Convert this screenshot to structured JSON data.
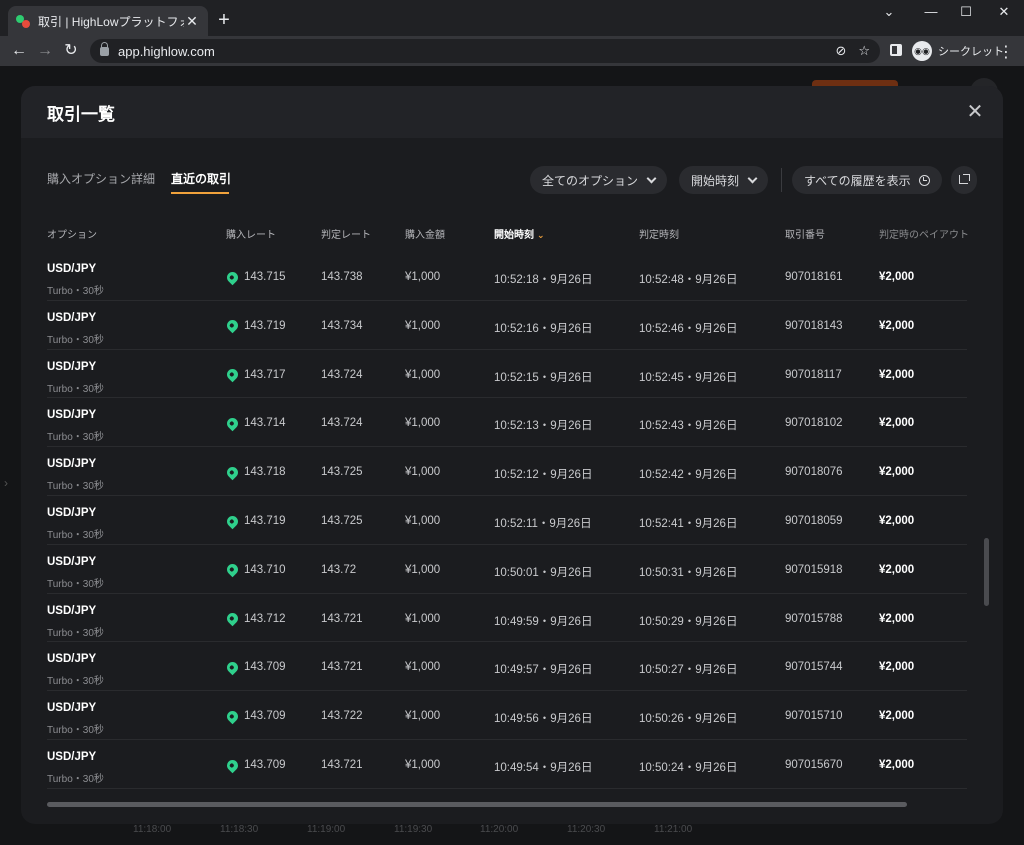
{
  "browser": {
    "tab_title": "取引 | HighLowプラットフォーム",
    "tab_close": "✕",
    "new_tab": "+",
    "url": "app.highlow.com",
    "incognito_label": "シークレット",
    "window_controls": {
      "minimize": "—",
      "maximize": "☐",
      "close": "✕",
      "dropdown": "⌄"
    }
  },
  "background": {
    "times": [
      "11:18:00",
      "11:18:30",
      "11:19:00",
      "11:19:30",
      "11:20:00",
      "11:20:30",
      "11:21:00"
    ]
  },
  "modal": {
    "title": "取引一覧",
    "close": "✕",
    "tabs": [
      {
        "label": "購入オプション詳細",
        "active": false
      },
      {
        "label": "直近の取引",
        "active": true
      }
    ],
    "filters": {
      "options_label": "全てのオプション",
      "start_time_label": "開始時刻",
      "history_label": "すべての履歴を表示"
    },
    "columns": [
      "オプション",
      "購入レート",
      "判定レート",
      "購入金額",
      "開始時刻",
      "判定時刻",
      "取引番号",
      "判定時のペイアウト"
    ],
    "sorted_column_arrow": "⌄",
    "rows": [
      {
        "pair": "USD/JPY",
        "type": "Turbo・30秒",
        "buy_rate": "143.715",
        "judge_rate": "143.738",
        "amount": "¥1,000",
        "start": "10:52:18・9月26日",
        "end": "10:52:48・9月26日",
        "trade_id": "907018161",
        "payout": "¥2,000"
      },
      {
        "pair": "USD/JPY",
        "type": "Turbo・30秒",
        "buy_rate": "143.719",
        "judge_rate": "143.734",
        "amount": "¥1,000",
        "start": "10:52:16・9月26日",
        "end": "10:52:46・9月26日",
        "trade_id": "907018143",
        "payout": "¥2,000"
      },
      {
        "pair": "USD/JPY",
        "type": "Turbo・30秒",
        "buy_rate": "143.717",
        "judge_rate": "143.724",
        "amount": "¥1,000",
        "start": "10:52:15・9月26日",
        "end": "10:52:45・9月26日",
        "trade_id": "907018117",
        "payout": "¥2,000"
      },
      {
        "pair": "USD/JPY",
        "type": "Turbo・30秒",
        "buy_rate": "143.714",
        "judge_rate": "143.724",
        "amount": "¥1,000",
        "start": "10:52:13・9月26日",
        "end": "10:52:43・9月26日",
        "trade_id": "907018102",
        "payout": "¥2,000"
      },
      {
        "pair": "USD/JPY",
        "type": "Turbo・30秒",
        "buy_rate": "143.718",
        "judge_rate": "143.725",
        "amount": "¥1,000",
        "start": "10:52:12・9月26日",
        "end": "10:52:42・9月26日",
        "trade_id": "907018076",
        "payout": "¥2,000"
      },
      {
        "pair": "USD/JPY",
        "type": "Turbo・30秒",
        "buy_rate": "143.719",
        "judge_rate": "143.725",
        "amount": "¥1,000",
        "start": "10:52:11・9月26日",
        "end": "10:52:41・9月26日",
        "trade_id": "907018059",
        "payout": "¥2,000"
      },
      {
        "pair": "USD/JPY",
        "type": "Turbo・30秒",
        "buy_rate": "143.710",
        "judge_rate": "143.72",
        "amount": "¥1,000",
        "start": "10:50:01・9月26日",
        "end": "10:50:31・9月26日",
        "trade_id": "907015918",
        "payout": "¥2,000"
      },
      {
        "pair": "USD/JPY",
        "type": "Turbo・30秒",
        "buy_rate": "143.712",
        "judge_rate": "143.721",
        "amount": "¥1,000",
        "start": "10:49:59・9月26日",
        "end": "10:50:29・9月26日",
        "trade_id": "907015788",
        "payout": "¥2,000"
      },
      {
        "pair": "USD/JPY",
        "type": "Turbo・30秒",
        "buy_rate": "143.709",
        "judge_rate": "143.721",
        "amount": "¥1,000",
        "start": "10:49:57・9月26日",
        "end": "10:50:27・9月26日",
        "trade_id": "907015744",
        "payout": "¥2,000"
      },
      {
        "pair": "USD/JPY",
        "type": "Turbo・30秒",
        "buy_rate": "143.709",
        "judge_rate": "143.722",
        "amount": "¥1,000",
        "start": "10:49:56・9月26日",
        "end": "10:50:26・9月26日",
        "trade_id": "907015710",
        "payout": "¥2,000"
      },
      {
        "pair": "USD/JPY",
        "type": "Turbo・30秒",
        "buy_rate": "143.709",
        "judge_rate": "143.721",
        "amount": "¥1,000",
        "start": "10:49:54・9月26日",
        "end": "10:50:24・9月26日",
        "trade_id": "907015670",
        "payout": "¥2,000"
      }
    ]
  },
  "colors": {
    "accent": "#f0a23c",
    "high_marker": "#2fd08c",
    "modal_bg": "#1b1c1f"
  }
}
